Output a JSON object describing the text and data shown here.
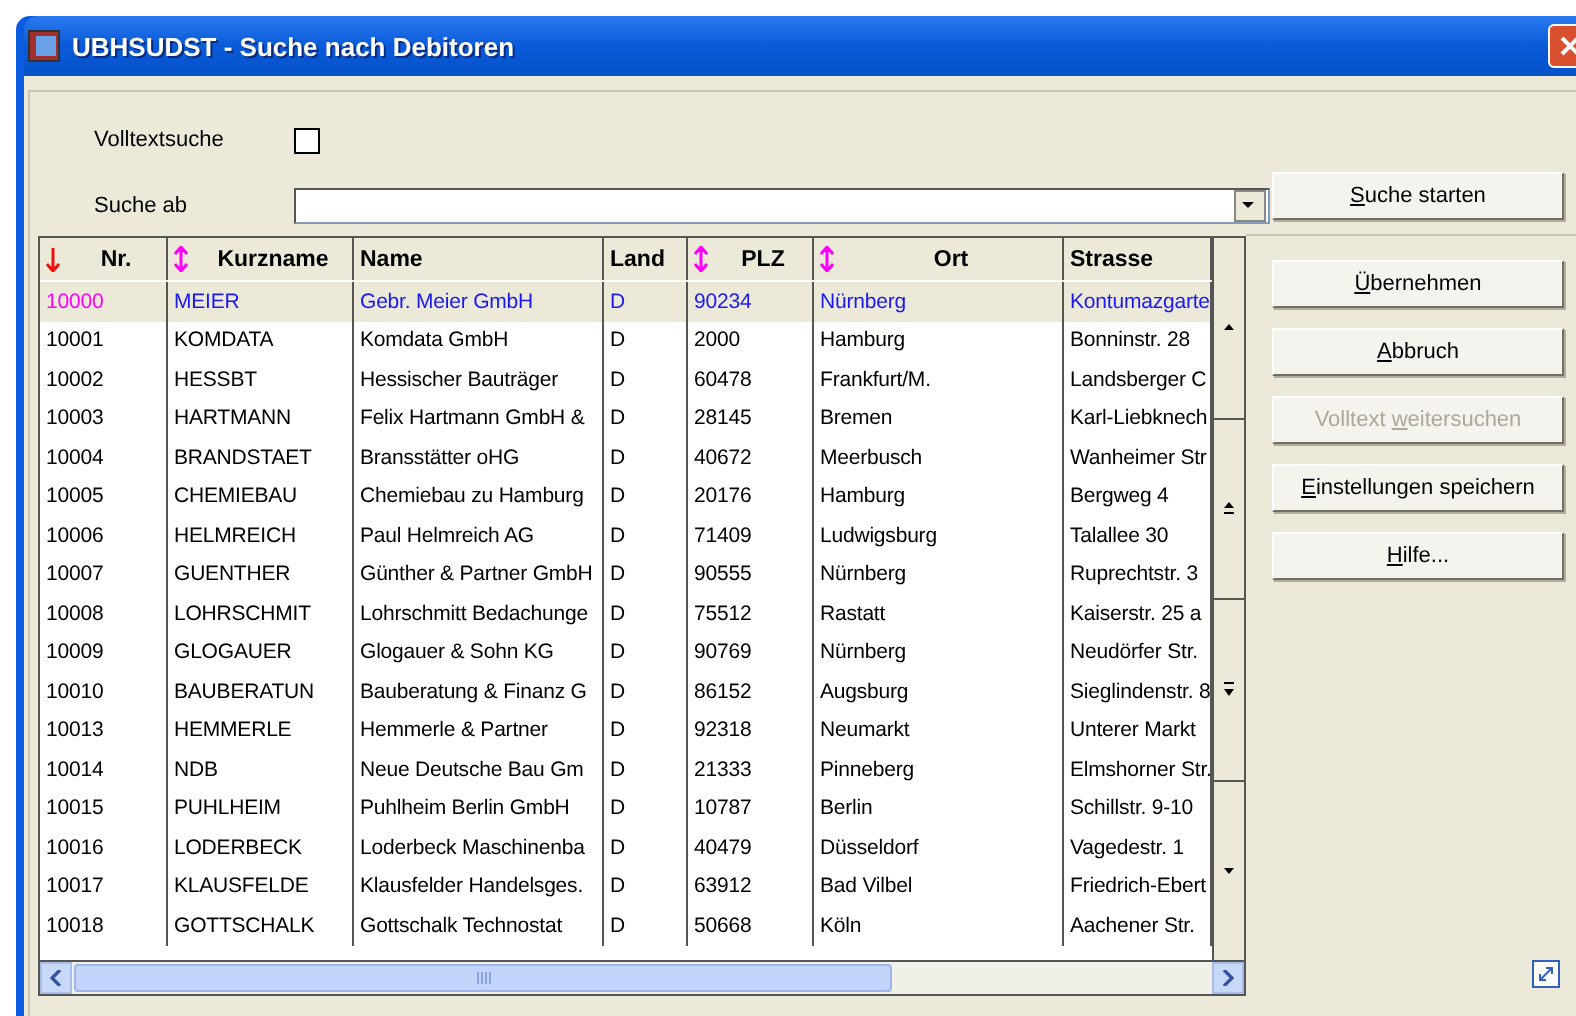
{
  "window": {
    "title": "UBHSUDST - Suche nach Debitoren"
  },
  "fulltext": {
    "label": "Volltextsuche",
    "checked": false
  },
  "search_from": {
    "label": "Suche ab"
  },
  "search_button": {
    "key": "S",
    "label_rest": "uche starten"
  },
  "table": {
    "columns": [
      {
        "label": "Nr.",
        "kind": "sorted"
      },
      {
        "label": "Kurzname",
        "kind": "sortable"
      },
      {
        "label": "Name",
        "kind": "plain"
      },
      {
        "label": "Land",
        "kind": "plain"
      },
      {
        "label": "PLZ",
        "kind": "sortable"
      },
      {
        "label": "Ort",
        "kind": "sortable"
      },
      {
        "label": "Strasse",
        "kind": "plain"
      }
    ],
    "rows": [
      {
        "selected": true,
        "cells": [
          "10000",
          "MEIER",
          "Gebr. Meier GmbH",
          "D",
          "90234",
          "Nürnberg",
          "Kontumazgarte"
        ]
      },
      {
        "selected": false,
        "cells": [
          "10001",
          "KOMDATA",
          "Komdata GmbH",
          "D",
          "2000",
          "Hamburg",
          "Bonninstr. 28"
        ]
      },
      {
        "selected": false,
        "cells": [
          "10002",
          "HESSBT",
          "Hessischer Bauträger",
          "D",
          "60478",
          "Frankfurt/M.",
          "Landsberger C"
        ]
      },
      {
        "selected": false,
        "cells": [
          "10003",
          "HARTMANN",
          "Felix Hartmann GmbH &",
          "D",
          "28145",
          "Bremen",
          "Karl-Liebknech"
        ]
      },
      {
        "selected": false,
        "cells": [
          "10004",
          "BRANDSTAET",
          "Bransstätter oHG",
          "D",
          "40672",
          "Meerbusch",
          "Wanheimer Str"
        ]
      },
      {
        "selected": false,
        "cells": [
          "10005",
          "CHEMIEBAU",
          "Chemiebau zu Hamburg",
          "D",
          "20176",
          "Hamburg",
          "Bergweg 4"
        ]
      },
      {
        "selected": false,
        "cells": [
          "10006",
          "HELMREICH",
          "Paul Helmreich AG",
          "D",
          "71409",
          "Ludwigsburg",
          "Talallee 30"
        ]
      },
      {
        "selected": false,
        "cells": [
          "10007",
          "GUENTHER",
          "Günther & Partner GmbH",
          "D",
          "90555",
          "Nürnberg",
          "Ruprechtstr. 3"
        ]
      },
      {
        "selected": false,
        "cells": [
          "10008",
          "LOHRSCHMIT",
          "Lohrschmitt Bedachunge",
          "D",
          "75512",
          "Rastatt",
          "Kaiserstr. 25 a"
        ]
      },
      {
        "selected": false,
        "cells": [
          "10009",
          "GLOGAUER",
          "Glogauer & Sohn KG",
          "D",
          "90769",
          "Nürnberg",
          "Neudörfer Str."
        ]
      },
      {
        "selected": false,
        "cells": [
          "10010",
          "BAUBERATUN",
          "Bauberatung & Finanz G",
          "D",
          "86152",
          "Augsburg",
          "Sieglindenstr. 8"
        ]
      },
      {
        "selected": false,
        "cells": [
          "10013",
          "HEMMERLE",
          "Hemmerle & Partner",
          "D",
          "92318",
          "Neumarkt",
          "Unterer Markt"
        ]
      },
      {
        "selected": false,
        "cells": [
          "10014",
          "NDB",
          "Neue Deutsche Bau Gm",
          "D",
          "21333",
          "Pinneberg",
          "Elmshorner Str."
        ]
      },
      {
        "selected": false,
        "cells": [
          "10015",
          "PUHLHEIM",
          "Puhlheim Berlin GmbH",
          "D",
          "10787",
          "Berlin",
          "Schillstr. 9-10"
        ]
      },
      {
        "selected": false,
        "cells": [
          "10016",
          "LODERBECK",
          "Loderbeck Maschinenba",
          "D",
          "40479",
          "Düsseldorf",
          "Vagedestr. 1"
        ]
      },
      {
        "selected": false,
        "cells": [
          "10017",
          "KLAUSFELDE",
          "Klausfelder Handelsges.",
          "D",
          "63912",
          "Bad Vilbel",
          "Friedrich-Ebert"
        ]
      },
      {
        "selected": false,
        "cells": [
          "10018",
          "GOTTSCHALK",
          "Gottschalk Technostat",
          "D",
          "50668",
          "Köln",
          "Aachener Str."
        ]
      }
    ]
  },
  "buttons": [
    {
      "key": "Ü",
      "label_rest": "bernehmen",
      "disabled": false
    },
    {
      "key": "A",
      "label_rest": "bbruch",
      "disabled": false
    },
    {
      "label_start": "Volltext ",
      "key": "w",
      "label_rest": "eitersuchen",
      "disabled": true
    },
    {
      "key": "E",
      "label_rest": "instellungen speichern",
      "disabled": false
    },
    {
      "key": "H",
      "label_rest": "ilfe...",
      "disabled": false
    }
  ]
}
